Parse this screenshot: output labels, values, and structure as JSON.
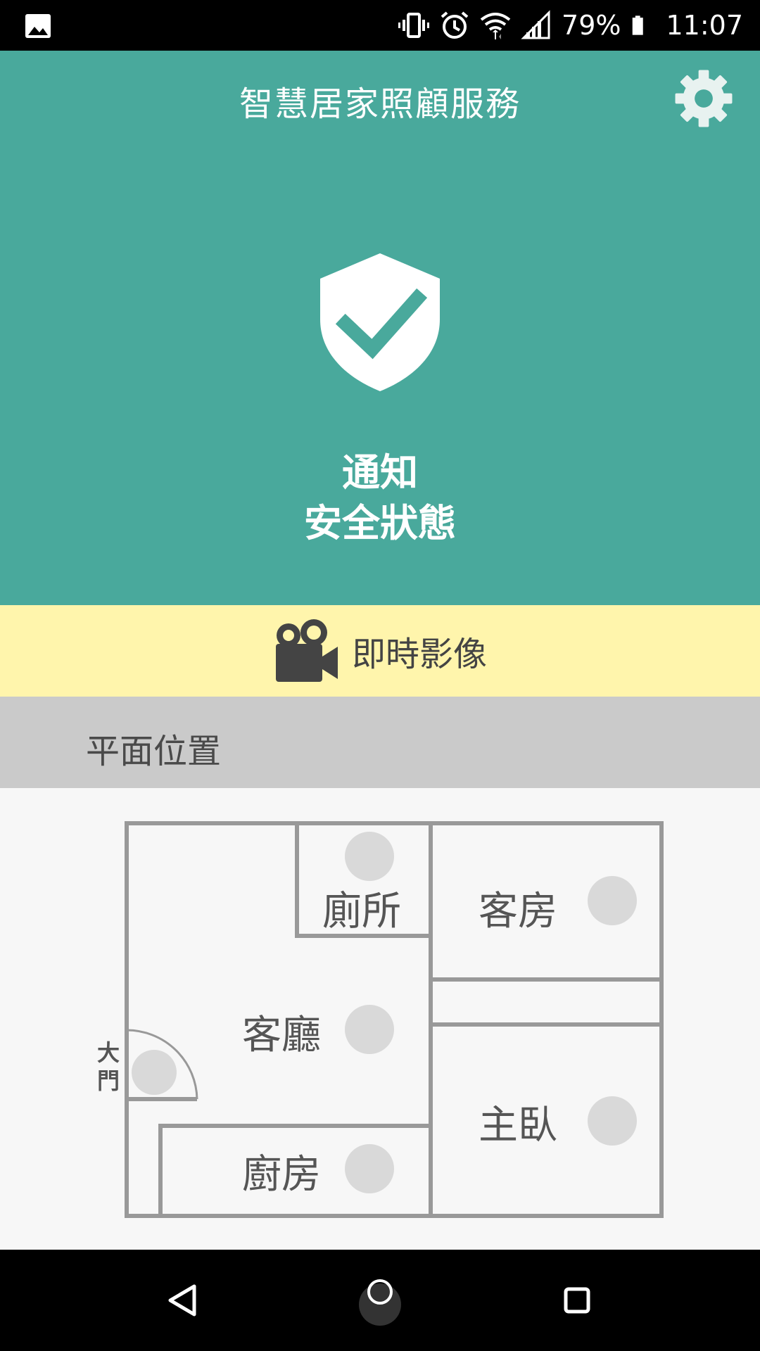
{
  "status_bar": {
    "battery_percent": "79%",
    "time": "11:07",
    "icons": [
      "image-icon",
      "vibrate-icon",
      "alarm-icon",
      "wifi-icon",
      "signal-icon",
      "battery-icon"
    ]
  },
  "header": {
    "title": "智慧居家照顧服務",
    "settings_icon": "gear-icon"
  },
  "hero": {
    "status_icon": "shield-check-icon",
    "line1": "通知",
    "line2": "安全狀態"
  },
  "live_video": {
    "icon": "video-camera-icon",
    "label": "即時影像"
  },
  "floor_plan": {
    "section_title": "平面位置",
    "door_label_1": "大",
    "door_label_2": "門",
    "rooms": {
      "toilet": "廁所",
      "guest_room": "客房",
      "living_room": "客廳",
      "kitchen": "廚房",
      "master_bedroom": "主臥"
    }
  },
  "colors": {
    "teal": "#49a99c",
    "yellow": "#fff5ac",
    "section_gray": "#cacaca",
    "sensor_gray": "#d9d9d9"
  },
  "nav": {
    "back_icon": "back-triangle-icon",
    "home_icon": "home-circle-icon",
    "recents_icon": "recents-square-icon"
  }
}
